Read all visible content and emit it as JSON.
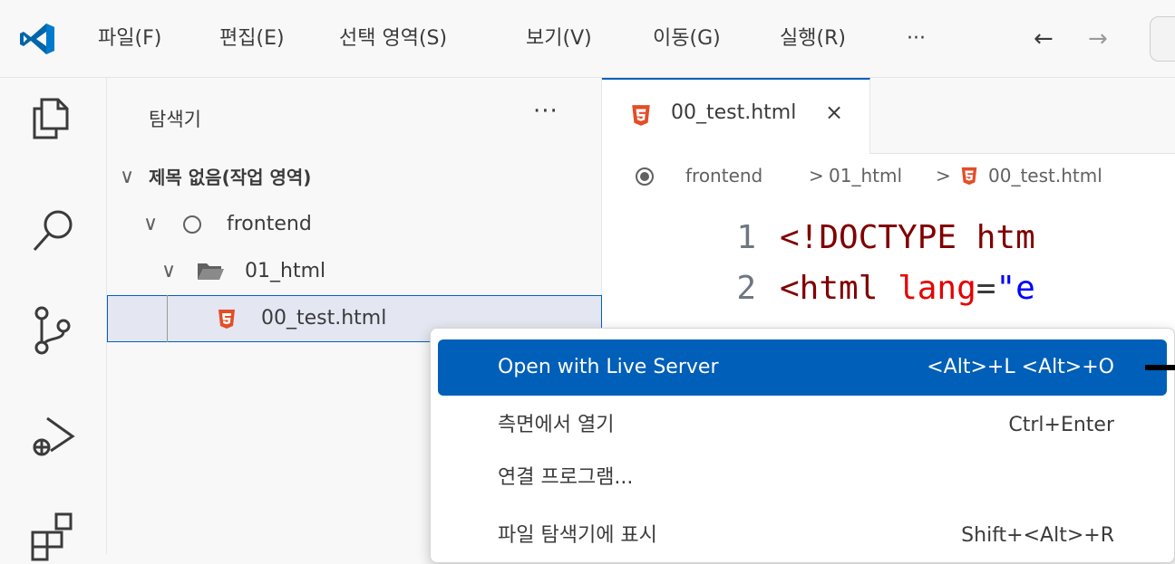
{
  "titlebar": {
    "menu": [
      "파일(F)",
      "편집(E)",
      "선택 영역(S)",
      "보기(V)",
      "이동(G)",
      "실행(R)",
      "···"
    ],
    "back_arrow": "←",
    "forward_arrow": "→"
  },
  "activity_icons": [
    "explorer-icon",
    "search-icon",
    "source-control-icon",
    "run-debug-icon",
    "extensions-icon"
  ],
  "sidebar": {
    "title": "탐색기",
    "more": "···",
    "workspace": "제목 없음(작업 영역)",
    "folder_root": "frontend",
    "folder_sub": "01_html",
    "file": "00_test.html"
  },
  "editor": {
    "tab_label": "00_test.html",
    "tab_close": "×",
    "breadcrumb": {
      "root": "frontend",
      "sep": ">",
      "folder": "01_html",
      "file": "00_test.html"
    },
    "lines": [
      {
        "num": "1",
        "text": "<!DOCTYPE htm"
      },
      {
        "num": "2",
        "tag": "<html",
        "attr": "lang",
        "eq": "=",
        "val": "\"e"
      }
    ]
  },
  "context_menu": {
    "items": [
      {
        "label": "Open with Live Server",
        "shortcut": "<Alt>+L <Alt>+O"
      },
      {
        "label": "측면에서 열기",
        "shortcut": "Ctrl+Enter"
      },
      {
        "label": "연결 프로그램...",
        "shortcut": ""
      },
      {
        "label": "파일 탐색기에 표시",
        "shortcut": "Shift+<Alt>+R"
      }
    ]
  },
  "colors": {
    "accent": "#005fb8",
    "html_icon": "#e44d26",
    "selection_bg": "#e4e6f1",
    "code_tag": "#800000",
    "code_attr": "#e50000",
    "code_string": "#0000ff"
  }
}
